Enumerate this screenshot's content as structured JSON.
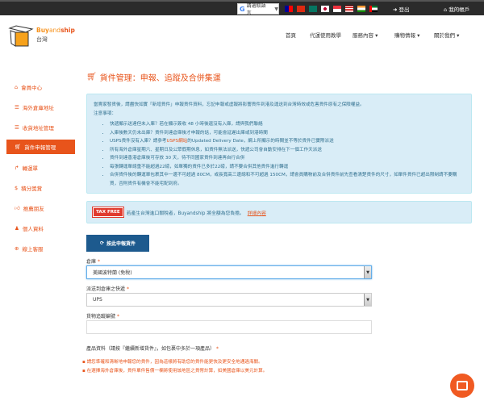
{
  "topbar": {
    "translate_label": "請選取語言",
    "logout": "登出",
    "account": "我的帳戶"
  },
  "brand": {
    "name_buy": "Buy",
    "name_and": "and",
    "name_ship": "ship",
    "region": "台灣"
  },
  "nav": [
    "首頁",
    "代運使用教學",
    "服務內容 ▾",
    "購物情報 ▾",
    "關於我們 ▾"
  ],
  "sidebar": [
    "會員中心",
    "海外倉庫地址",
    "收貨地址管理",
    "貨件申報管理",
    "轉運單",
    "積分獎賞",
    "推薦朋友",
    "個人資料",
    "線上客服"
  ],
  "page_title": "貨件管理：申報、追蹤及合併集運",
  "info": {
    "intro": "當賣家發貨後，請盡快如實「新增貨件」申報貨件資料，忘記申報或虛報將影響貨件到港及運送到台灣時效或危害貨件原有之保險權益。",
    "notice": "注意事項：",
    "items": [
      "快遞顯示送達但未入庫？若在顯示簽收 48 小時後還沒有入庫，請與我們聯絡",
      "入庫後數天仍未出庫？貨件到達倉庫後才申報的話，可能會延遲出庫或到港時間",
      "所有海外倉庫星期六、星期日及公眾假期休息，如貨件無法派送，快遞公司會自動安排在下一個工作天派送",
      "貨件到達香港倉庫後可存放 30 天，待不同國家貨件到達再自行合併",
      "每張轉運單總重不能超過22磅，如單獨的貨件已多於22磅，請不要合併其他貨件進行轉運",
      "合併貨件後的轉運單包裹其中一邊不可超過 80CM，或長寬高三邊總和不可超過 150CM，請會員購物前及合併貨件前先查看清楚貨件的尺寸，如單件貨件已超出限制請不要購買，否則貨件有機會不能宅配到府。"
    ],
    "usps_pre": "USPS貨件沒有入庫？請參考",
    "usps_link": "USPS網站",
    "usps_post": "的Updated Delivery Date，網上所顯示的時間並不等於貨件已實際派送"
  },
  "tax": {
    "badge": "TAX FREE",
    "text": "若產生台灣進口關稅者，Buyandship 將全額為您負擔。",
    "link": "詳細內容"
  },
  "declare_button": "按此申報貨件",
  "form": {
    "warehouse_label": "倉庫",
    "warehouse_value": "美國波特蘭 (免稅)",
    "courier_label": "派送到倉庫之快遞",
    "courier_value": "UPS",
    "tracking_label": "貨物追蹤編號",
    "tracking_value": "",
    "required": "*"
  },
  "product_label": "產品資料（請按『繼續新增貨件』，如包裹中多於一項產品）",
  "notes": [
    "請您準確和清晰地申報您的貨件，因為這樣將有助您的貨件能更快及更安全地通過海關。",
    "在選擇海外倉庫後，貨件單件售價一欄將使用該地區之貨幣計算，如美國倉庫以美元計算。"
  ],
  "colors": {
    "accent": "#e8541b",
    "info_bg": "#d9edf7",
    "button": "#1d5a8e"
  }
}
